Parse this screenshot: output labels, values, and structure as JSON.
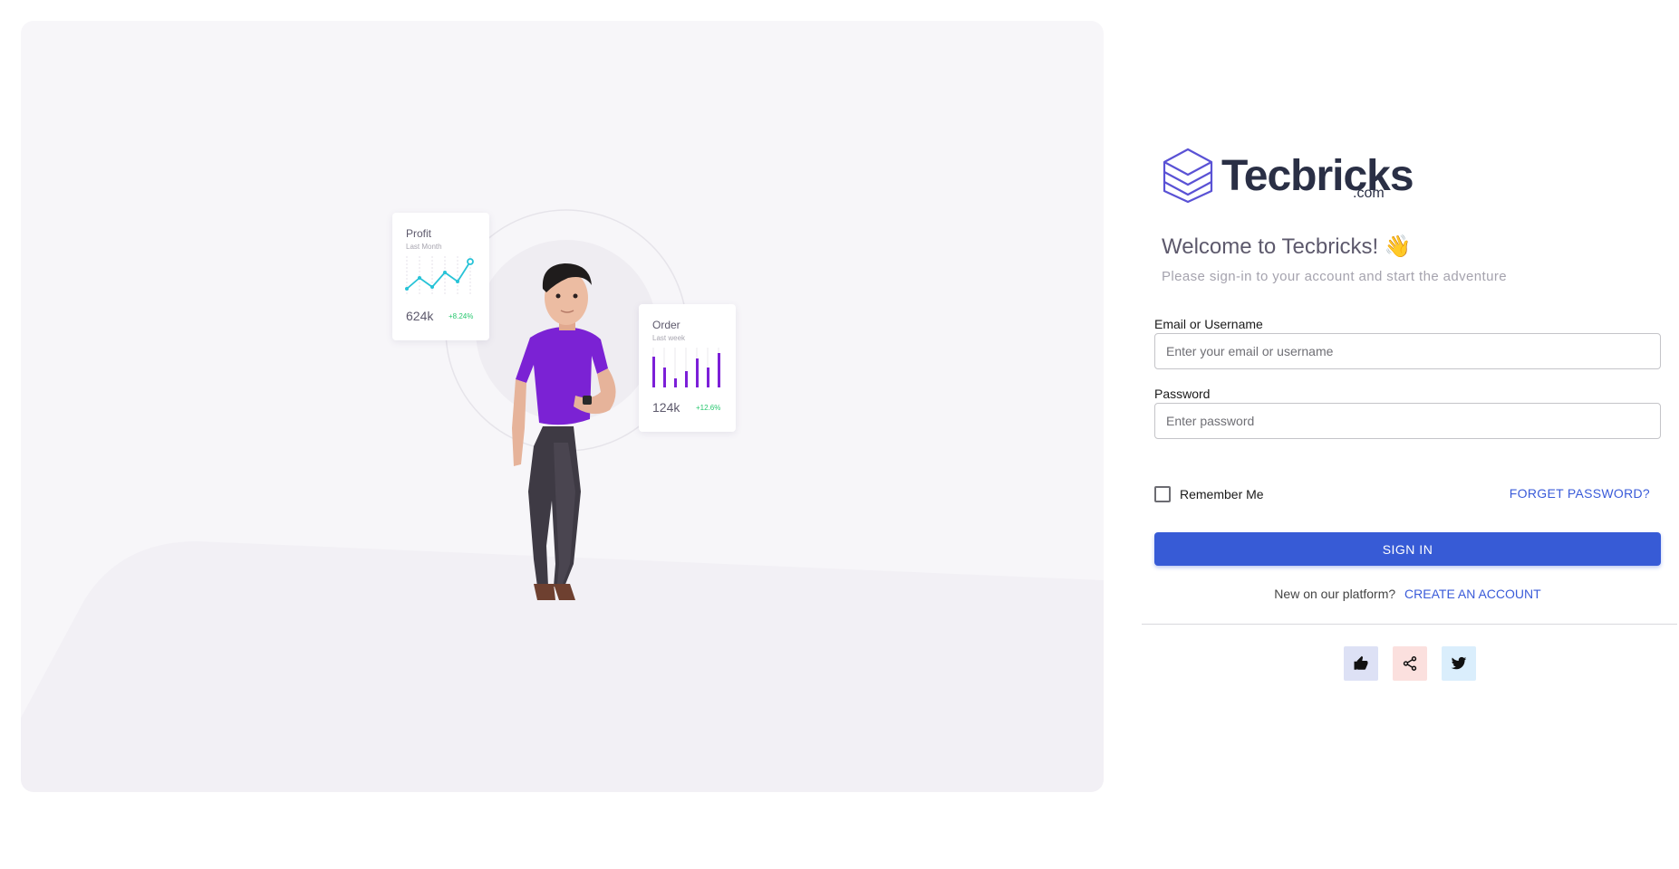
{
  "illustration": {
    "profit_card": {
      "title": "Profit",
      "subtitle": "Last Month",
      "value": "624k",
      "change": "+8.24%"
    },
    "order_card": {
      "title": "Order",
      "subtitle": "Last week",
      "value": "124k",
      "change": "+12.6%"
    },
    "colors": {
      "profit_line": "#28c3d7",
      "order_bars": "#7c1fd8",
      "shirt": "#7b22d4"
    }
  },
  "brand": {
    "name": "Tecbricks",
    "suffix": ".com",
    "logo_color": "#5a52d5"
  },
  "welcome": {
    "title": "Welcome to Tecbricks! 👋",
    "subtitle": "Please sign-in to your account and start the adventure"
  },
  "form": {
    "email_label": "Email or Username",
    "email_placeholder": "Enter your email or username",
    "email_value": "",
    "password_label": "Password",
    "password_placeholder": "Enter password",
    "password_value": "",
    "remember_label": "Remember Me",
    "remember_checked": false,
    "forgot_label": "FORGET PASSWORD?",
    "signin_label": "SIGN IN"
  },
  "signup": {
    "text": "New on our platform?",
    "link": "CREATE AN ACCOUNT"
  },
  "social": [
    {
      "icon": "thumbs-up-icon",
      "color": "#dde1f5"
    },
    {
      "icon": "share-icon",
      "color": "#fbe0de"
    },
    {
      "icon": "twitter-icon",
      "color": "#daeefc"
    }
  ],
  "accent_color": "#375bd6"
}
